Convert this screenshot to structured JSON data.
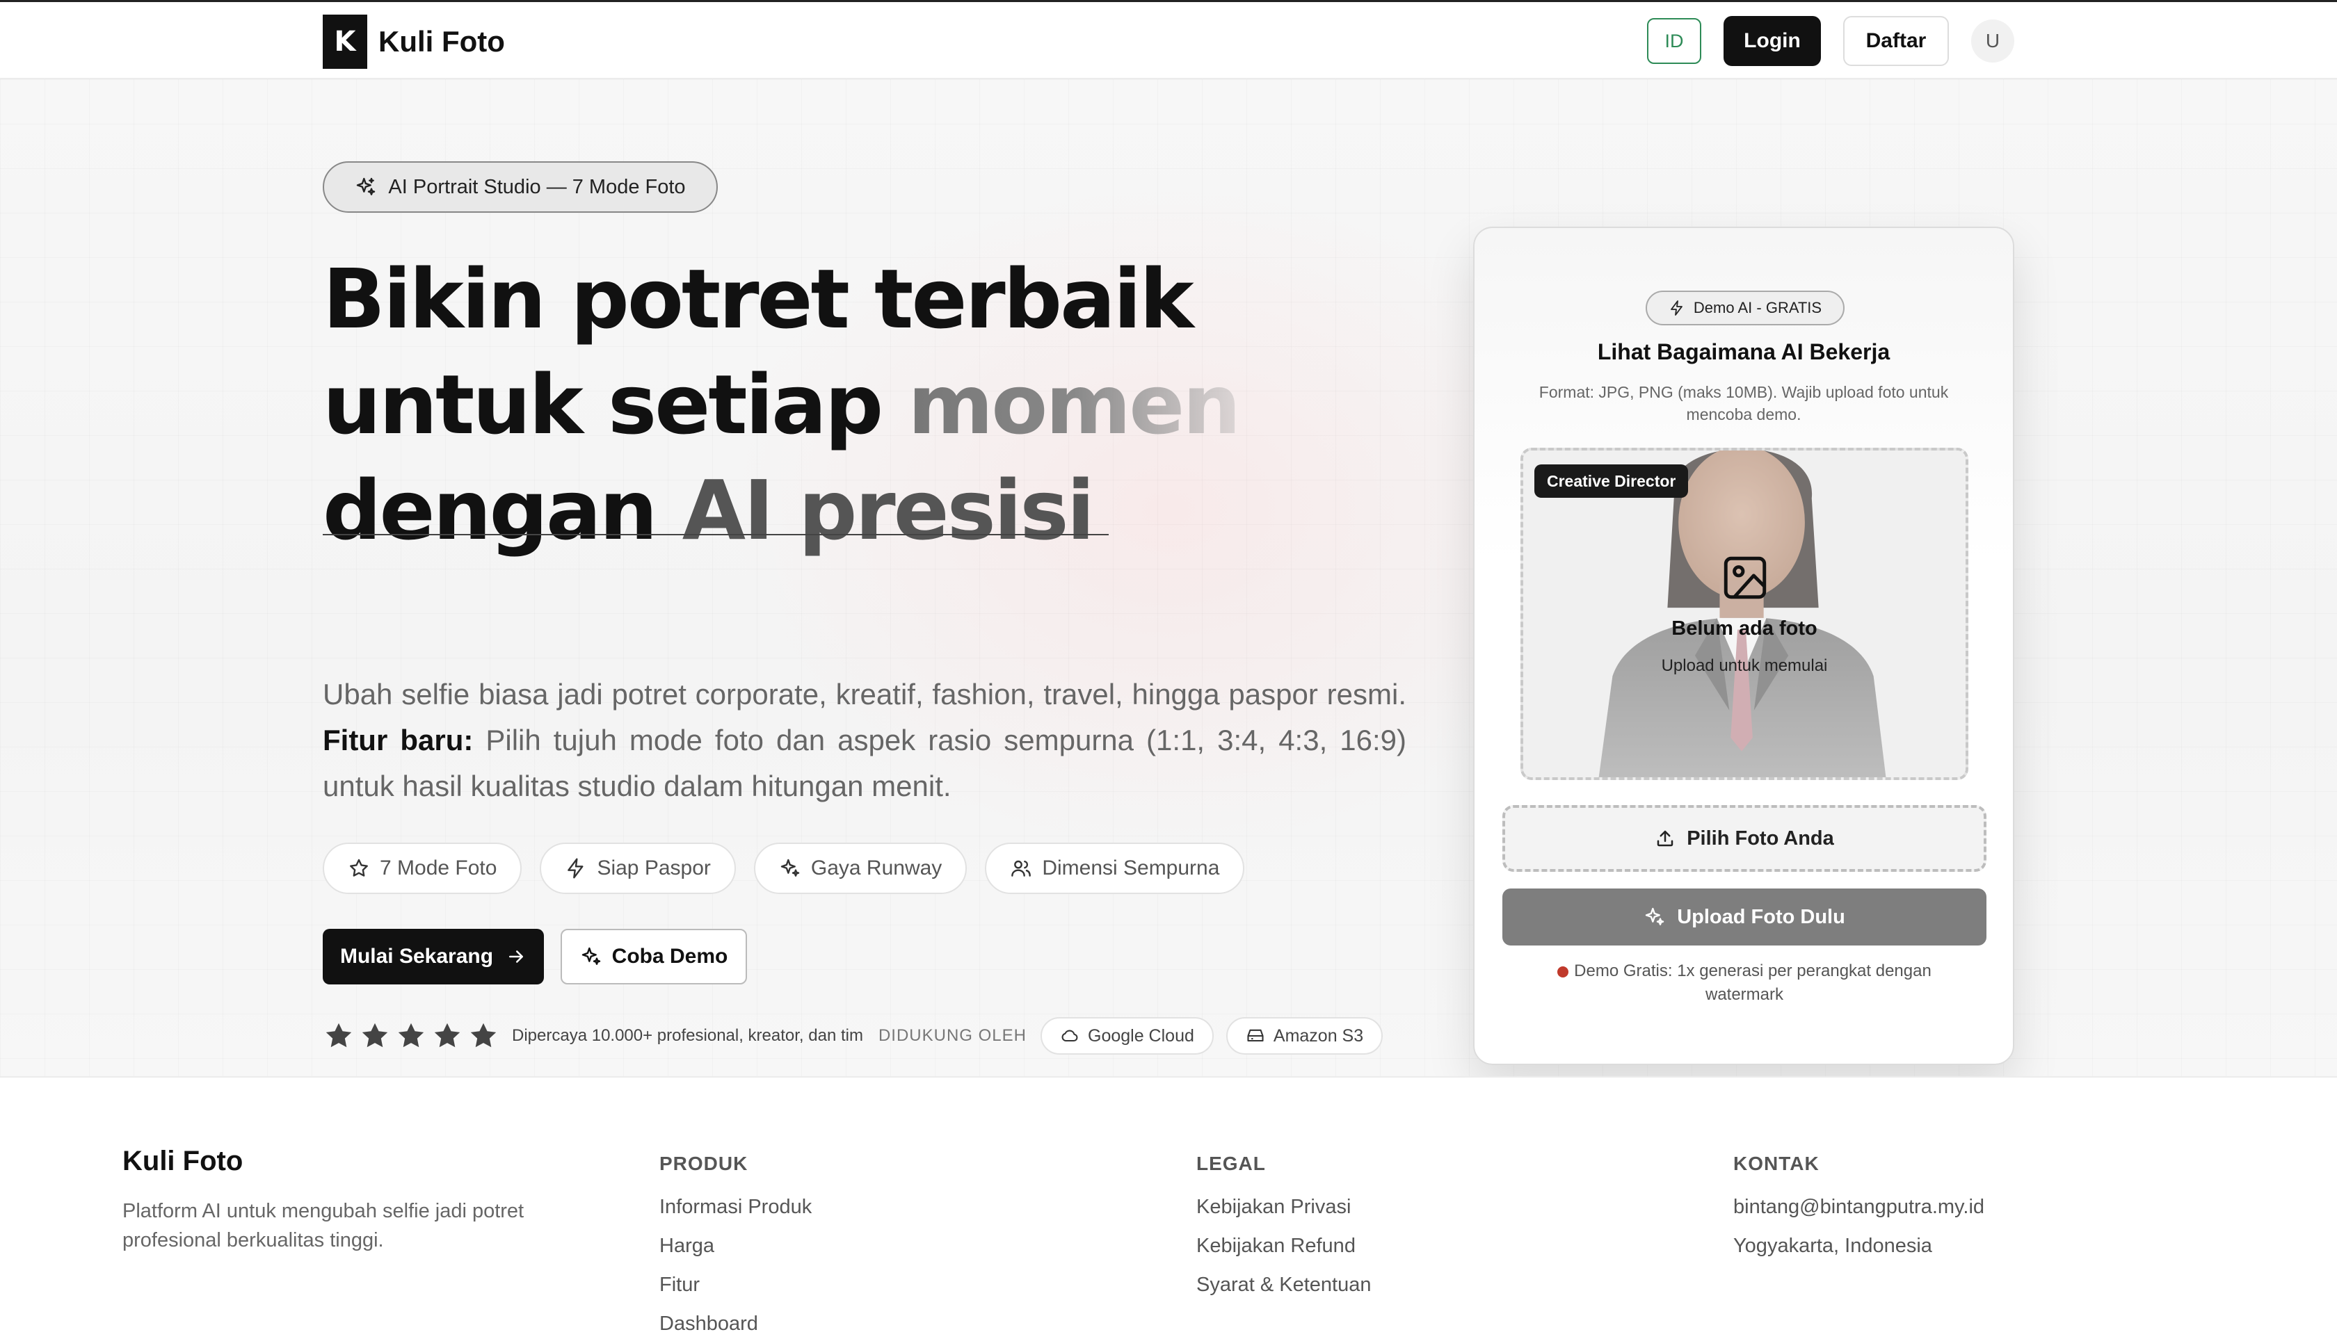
{
  "nav": {
    "brand_logo": "K",
    "brand_name": "Kuli Foto",
    "lang": "ID",
    "login": "Login",
    "register": "Daftar",
    "avatar": "U"
  },
  "hero": {
    "badge": "AI Portrait Studio — 7 Mode Foto",
    "headline": {
      "line1": "Bikin potret terbaik",
      "line2_a": "untuk setiap ",
      "line2_b": "momen",
      "line3_a": "dengan ",
      "line3_b": "AI presisi"
    },
    "lead_a": "Ubah selfie biasa jadi potret corporate, kreatif, fashion, travel, hingga paspor resmi. ",
    "lead_bold": "Fitur baru:",
    "lead_b": " Pilih tujuh mode foto dan aspek rasio sempurna (1:1, 3:4, 4:3, 16:9) untuk hasil kualitas studio dalam hitungan menit.",
    "features": [
      {
        "label": "7 Mode Foto",
        "icon": "star-icon"
      },
      {
        "label": "Siap Paspor",
        "icon": "bolt-icon"
      },
      {
        "label": "Gaya Runway",
        "icon": "sparkles-icon"
      },
      {
        "label": "Dimensi Sempurna",
        "icon": "users-icon"
      }
    ],
    "cta_primary": "Mulai Sekarang",
    "cta_secondary": "Coba Demo",
    "rating_stars": 5,
    "trust_text": "Dipercaya 10.000+ profesional, kreator, dan tim",
    "backed_by": "DIDUKUNG OLEH",
    "partners": [
      {
        "label": "Google Cloud",
        "icon": "cloud-icon"
      },
      {
        "label": "Amazon S3",
        "icon": "storage-icon"
      }
    ]
  },
  "demo": {
    "badge": "Demo AI - GRATIS",
    "title": "Lihat Bagaimana AI Bekerja",
    "desc": "Format: JPG, PNG (maks 10MB). Wajib upload foto untuk mencoba demo.",
    "role_tag": "Creative Director",
    "empty_title": "Belum ada foto",
    "empty_sub": "Upload untuk memulai",
    "pick_label": "Pilih Foto Anda",
    "upload_label": "Upload Foto Dulu",
    "note": "Demo Gratis: 1x generasi per perangkat dengan watermark"
  },
  "footer": {
    "brand": "Kuli Foto",
    "desc": "Platform AI untuk mengubah selfie jadi potret profesional berkualitas tinggi.",
    "columns": [
      {
        "heading": "PRODUK",
        "links": [
          "Informasi Produk",
          "Harga",
          "Fitur",
          "Dashboard"
        ]
      },
      {
        "heading": "LEGAL",
        "links": [
          "Kebijakan Privasi",
          "Kebijakan Refund",
          "Syarat & Ketentuan"
        ]
      },
      {
        "heading": "KONTAK",
        "links": [
          "bintang@bintangputra.my.id",
          "Yogyakarta, Indonesia"
        ]
      }
    ]
  }
}
